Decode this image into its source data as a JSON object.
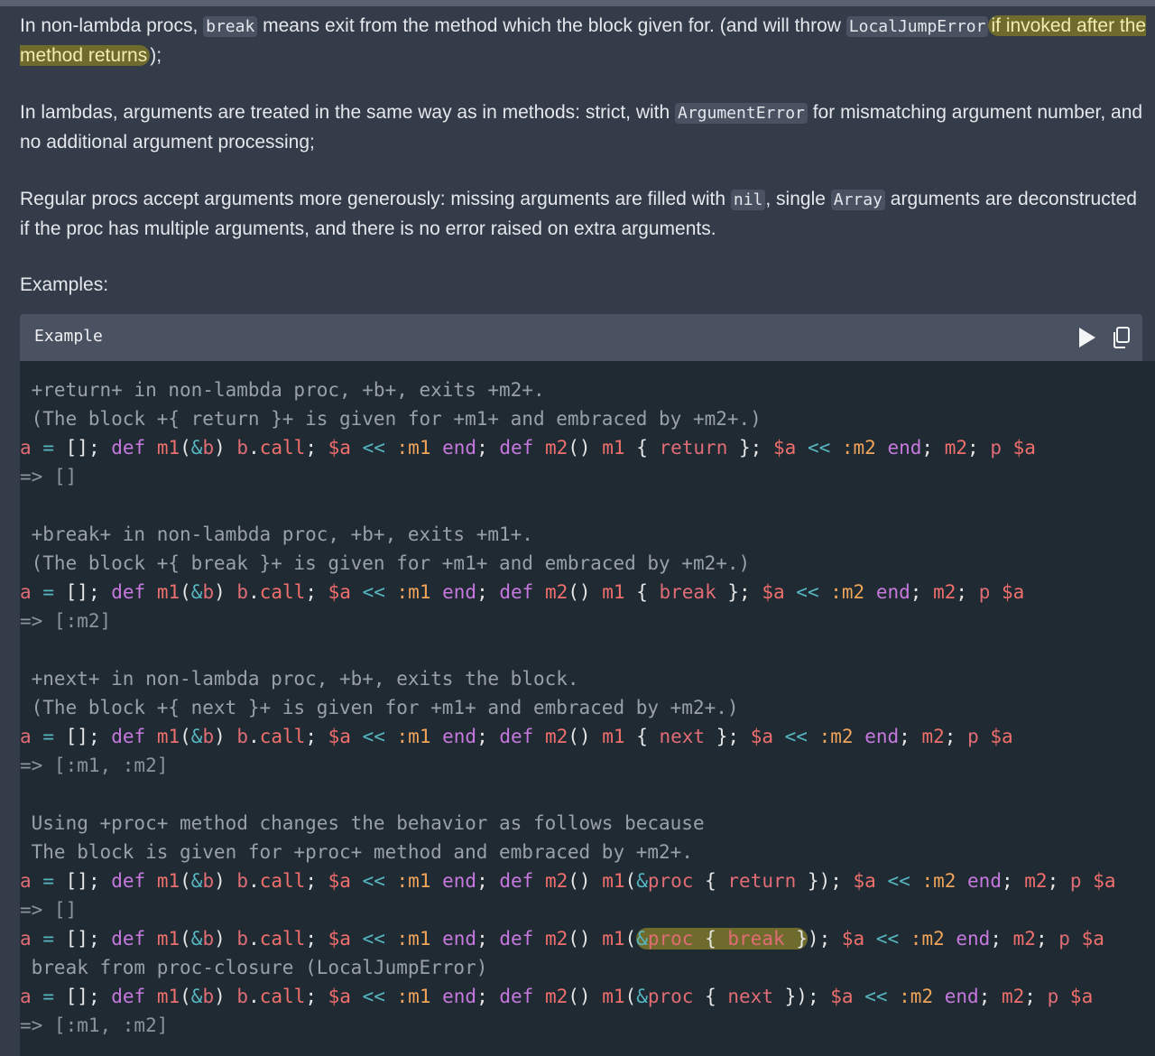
{
  "paragraphs": [
    {
      "segments": [
        {
          "t": "text",
          "v": "In non-lambda procs, "
        },
        {
          "t": "code",
          "v": "break"
        },
        {
          "t": "text",
          "v": " means exit from the method which the block given for. (and will throw "
        },
        {
          "t": "code",
          "v": "LocalJumpError"
        },
        {
          "t": "hl",
          "v": "if invoked after the method returns"
        },
        {
          "t": "text",
          "v": ");"
        }
      ]
    },
    {
      "segments": [
        {
          "t": "text",
          "v": "In lambdas, arguments are treated in the same way as in methods: strict, with "
        },
        {
          "t": "code",
          "v": "ArgumentError"
        },
        {
          "t": "text",
          "v": " for mismatching argument number, and no additional argument processing;"
        }
      ]
    },
    {
      "segments": [
        {
          "t": "text",
          "v": "Regular procs accept arguments more generously: missing arguments are filled with "
        },
        {
          "t": "code",
          "v": "nil"
        },
        {
          "t": "text",
          "v": ", single "
        },
        {
          "t": "code",
          "v": "Array"
        },
        {
          "t": "text",
          "v": " arguments are deconstructed if the proc has multiple arguments, and there is no error raised on extra arguments."
        }
      ]
    },
    {
      "segments": [
        {
          "t": "text",
          "v": "Examples:"
        }
      ]
    }
  ],
  "code_block": {
    "title": "Example",
    "run_icon": "play-icon",
    "copy_icon": "copy-icon",
    "lines": [
      {
        "kind": "comment",
        "text": " +return+ in non-lambda proc, +b+, exits +m2+."
      },
      {
        "kind": "comment",
        "text": " (The block +{ return }+ is given for +m1+ and embraced by +m2+.)"
      },
      {
        "kind": "code",
        "text": "a = []; def m1(&b) b.call; $a << :m1 end; def m2() m1 { return }; $a << :m2 end; m2; p $a"
      },
      {
        "kind": "result",
        "text": "=> []"
      },
      {
        "kind": "blank",
        "text": ""
      },
      {
        "kind": "comment",
        "text": " +break+ in non-lambda proc, +b+, exits +m1+."
      },
      {
        "kind": "comment",
        "text": " (The block +{ break }+ is given for +m1+ and embraced by +m2+.)"
      },
      {
        "kind": "code",
        "text": "a = []; def m1(&b) b.call; $a << :m1 end; def m2() m1 { break }; $a << :m2 end; m2; p $a"
      },
      {
        "kind": "result",
        "text": "=> [:m2]"
      },
      {
        "kind": "blank",
        "text": ""
      },
      {
        "kind": "comment",
        "text": " +next+ in non-lambda proc, +b+, exits the block."
      },
      {
        "kind": "comment",
        "text": " (The block +{ next }+ is given for +m1+ and embraced by +m2+.)"
      },
      {
        "kind": "code",
        "text": "a = []; def m1(&b) b.call; $a << :m1 end; def m2() m1 { next }; $a << :m2 end; m2; p $a"
      },
      {
        "kind": "result",
        "text": "=> [:m1, :m2]"
      },
      {
        "kind": "blank",
        "text": ""
      },
      {
        "kind": "comment",
        "text": " Using +proc+ method changes the behavior as follows because"
      },
      {
        "kind": "comment",
        "text": " The block is given for +proc+ method and embraced by +m2+."
      },
      {
        "kind": "code",
        "text": "a = []; def m1(&b) b.call; $a << :m1 end; def m2() m1(&proc { return }); $a << :m2 end; m2; p $a"
      },
      {
        "kind": "result",
        "text": "=> []"
      },
      {
        "kind": "code",
        "text": "a = []; def m1(&b) b.call; $a << :m1 end; def m2() m1(&proc { break }); $a << :m2 end; m2; p $a",
        "highlight": "&proc { break }"
      },
      {
        "kind": "comment",
        "text": " break from proc-closure (LocalJumpError)"
      },
      {
        "kind": "code",
        "text": "a = []; def m1(&b) b.call; $a << :m1 end; def m2() m1(&proc { next }); $a << :m2 end; m2; p $a"
      },
      {
        "kind": "result",
        "text": "=> [:m1, :m2]"
      }
    ]
  },
  "colors": {
    "page_bg": "#353c49",
    "code_bg": "#1f2a33",
    "highlight": "#6e6b2c",
    "keyword": "#c678dd",
    "variable": "#e06c75",
    "symbol": "#f0a45a",
    "operator": "#56b6c2"
  }
}
